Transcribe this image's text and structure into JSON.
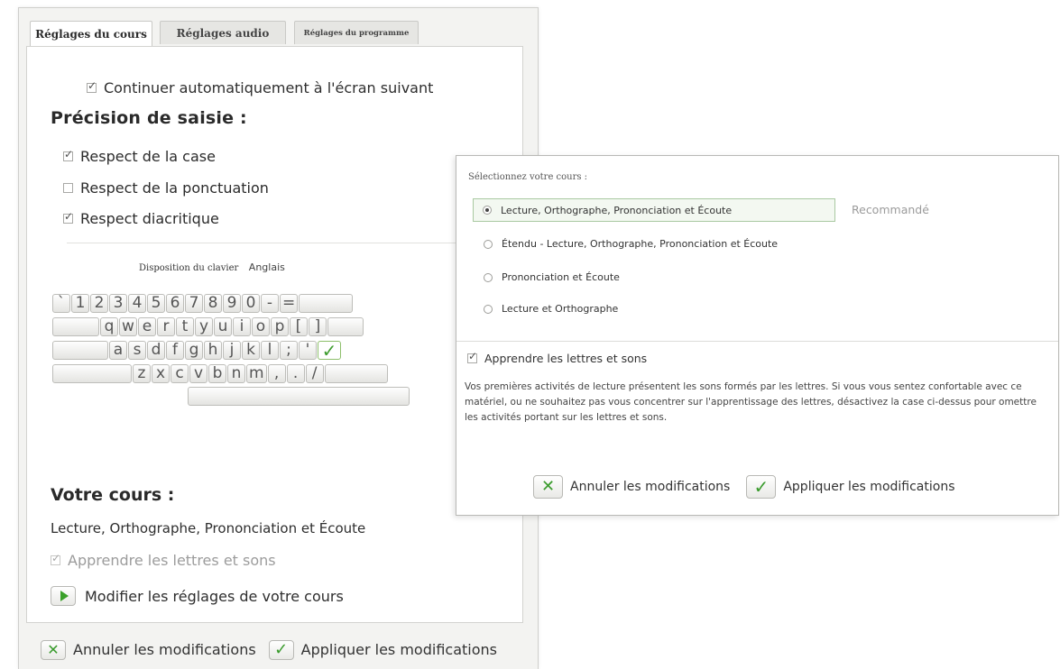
{
  "tabs": [
    "Réglages du cours",
    "Réglages audio",
    "Réglages du programme"
  ],
  "left": {
    "auto_continue": "Continuer automatiquement à l'écran suivant",
    "precision_heading": "Précision de saisie :",
    "options": [
      "Respect de la case",
      "Respect de la ponctuation",
      "Respect diacritique"
    ],
    "options_checked": [
      true,
      false,
      true
    ],
    "keyboard_layout_label": "Disposition du clavier",
    "keyboard_layout_value": "Anglais",
    "keyboard": {
      "row1": [
        "`",
        "1",
        "2",
        "3",
        "4",
        "5",
        "6",
        "7",
        "8",
        "9",
        "0",
        "-",
        "="
      ],
      "row2": [
        "q",
        "w",
        "e",
        "r",
        "t",
        "y",
        "u",
        "i",
        "o",
        "p",
        "[",
        "]"
      ],
      "row3": [
        "a",
        "s",
        "d",
        "f",
        "g",
        "h",
        "j",
        "k",
        "l",
        ";",
        "'"
      ],
      "row4": [
        "z",
        "x",
        "c",
        "v",
        "b",
        "n",
        "m",
        ",",
        ".",
        "/"
      ]
    },
    "course_heading": "Votre cours :",
    "course_name": "Lecture, Orthographe, Prononciation et Écoute",
    "learn_letters": "Apprendre les lettres et sons",
    "modify": "Modifier les réglages de votre cours",
    "cancel": "Annuler les modifications",
    "apply": "Appliquer les modifications"
  },
  "dialog": {
    "select_label": "Sélectionnez votre cours :",
    "courses": [
      "Lecture, Orthographe, Prononciation et Écoute",
      "Étendu - Lecture, Orthographe, Prononciation et Écoute",
      "Prononciation et Écoute",
      "Lecture et Orthographe"
    ],
    "recommended": "Recommandé",
    "learn_letters": "Apprendre les lettres et sons",
    "description": "Vos premières activités de lecture présentent les sons formés par les lettres. Si vous vous sentez confortable avec ce matériel, ou ne souhaitez pas vous concentrer sur l'apprentissage des lettres, désactivez la case ci-dessus pour omettre les activités portant sur les lettres et sons.",
    "cancel": "Annuler les modifications",
    "apply": "Appliquer les modifications"
  },
  "icons": {
    "check": "✓",
    "cross": "✕",
    "play": "play-icon"
  },
  "colors": {
    "accent_green": "#3a9b2d",
    "selected_row_bg": "#f3f8f1"
  }
}
